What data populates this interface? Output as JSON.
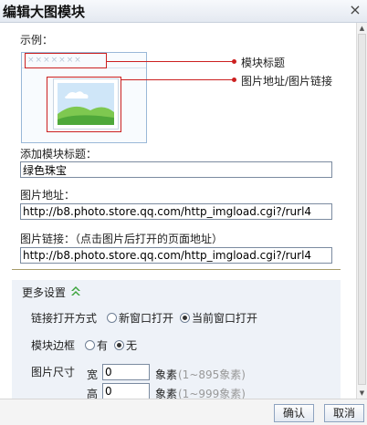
{
  "dialog": {
    "title": "编辑大图模块",
    "close_glyph": "×"
  },
  "example": {
    "label": "示例：",
    "placeholder_marks": "×××××××",
    "callouts": {
      "module_title": "模块标题",
      "image_link": "图片地址/图片链接"
    }
  },
  "module_title": {
    "label": "添加模块标题：",
    "value": "绿色珠宝"
  },
  "image_url": {
    "label": "图片地址：",
    "value": "http://b8.photo.store.qq.com/http_imgload.cgi?/rurl4"
  },
  "image_link": {
    "label": "图片链接：（点击图片后打开的页面地址）",
    "value": "http://b8.photo.store.qq.com/http_imgload.cgi?/rurl4"
  },
  "more_settings": {
    "label": "更多设置",
    "toggle_icon": "double-chevron-up-icon",
    "open_mode": {
      "label": "链接打开方式",
      "options": [
        {
          "label": "新窗口打开",
          "selected": false
        },
        {
          "label": "当前窗口打开",
          "selected": true
        }
      ]
    },
    "border": {
      "label": "模块边框",
      "options": [
        {
          "label": "有",
          "selected": false
        },
        {
          "label": "无",
          "selected": true
        }
      ]
    },
    "size": {
      "label": "图片尺寸",
      "width": {
        "label": "宽",
        "value": "0",
        "unit": "象素",
        "range": "(1~895象素)"
      },
      "height": {
        "label": "高",
        "value": "0",
        "unit": "象素",
        "range": "(1~999象素)"
      }
    }
  },
  "footer": {
    "confirm_label": "确认",
    "cancel_label": "取消"
  },
  "colors": {
    "accent_red": "#cc2020",
    "more_bg": "#eef2f8",
    "toggle_green": "#3aa33a"
  }
}
